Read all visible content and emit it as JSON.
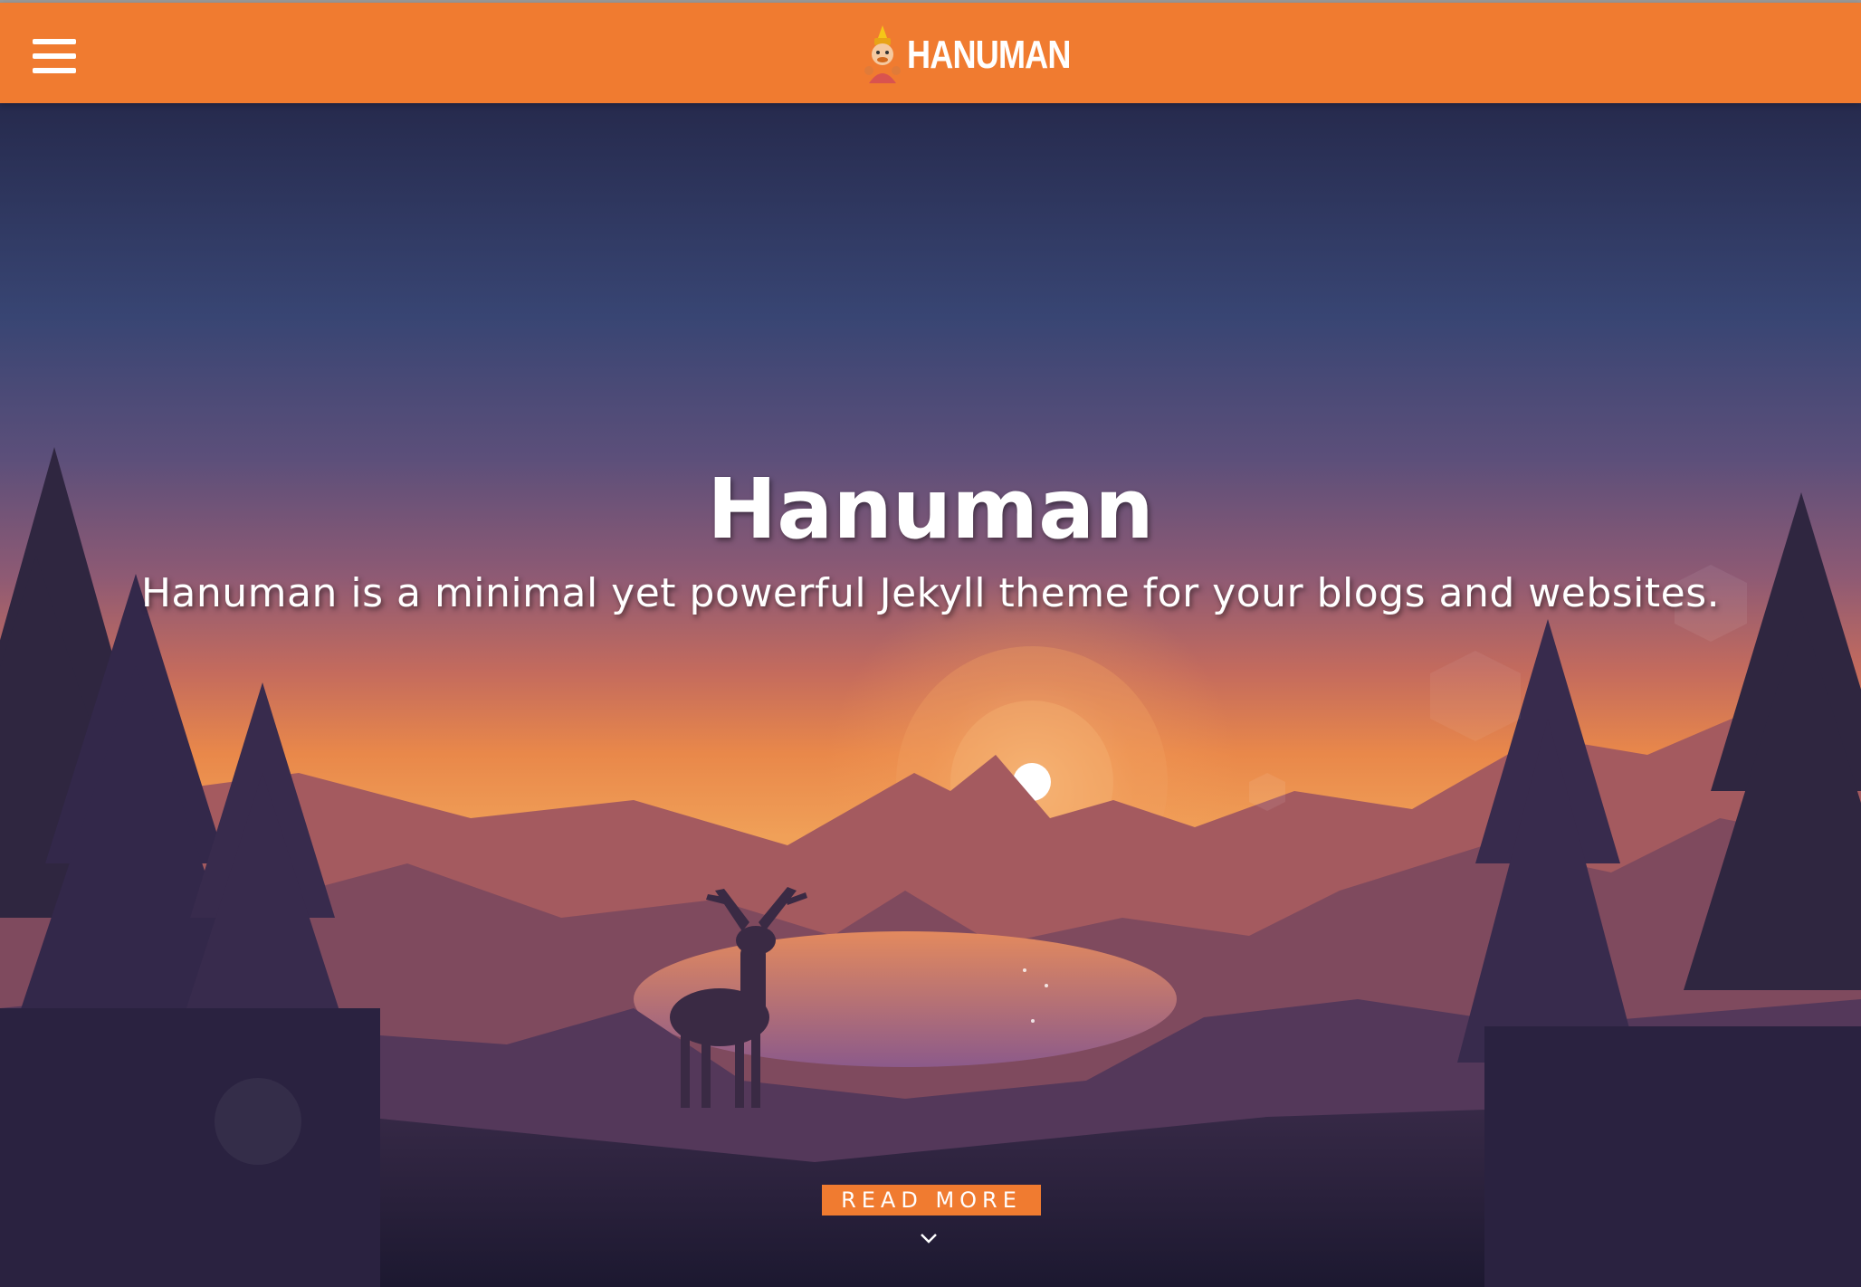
{
  "navbar": {
    "brand_text": "HANUMAN",
    "menu_icon": "hamburger-menu-icon",
    "logo_icon": "hanuman-logo-icon",
    "background_color": "#f07b30"
  },
  "hero": {
    "title": "Hanuman",
    "subtitle": "Hanuman is a minimal yet powerful Jekyll theme for your blogs and websites.",
    "read_more_label": "READ MORE",
    "scroll_icon": "chevron-down-icon",
    "accent_color": "#f07b30"
  }
}
